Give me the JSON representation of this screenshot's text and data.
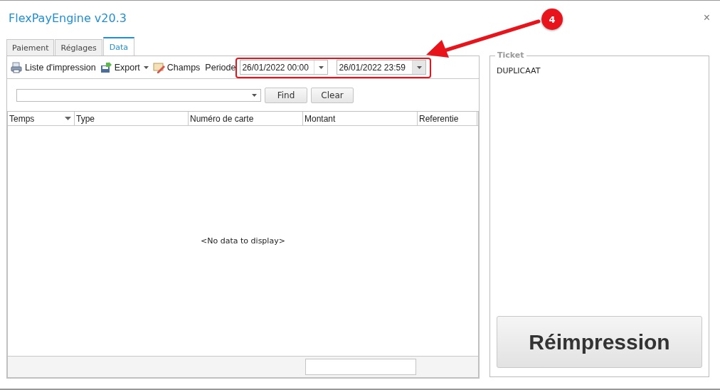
{
  "window": {
    "title": "FlexPayEngine v20.3",
    "close": "×"
  },
  "tabs": [
    {
      "label": "Paiement",
      "selected": false
    },
    {
      "label": "Réglages",
      "selected": false
    },
    {
      "label": "Data",
      "selected": true
    }
  ],
  "toolbar": {
    "items": [
      {
        "label": "Liste d'impression",
        "kind": "print"
      },
      {
        "label": "Export",
        "kind": "export"
      },
      {
        "label": "Champs",
        "kind": "fields"
      }
    ],
    "period_label": "Periode",
    "date_from": "26/01/2022 00:00",
    "date_to": "26/01/2022 23:59"
  },
  "search": {
    "find": "Find",
    "clear": "Clear"
  },
  "table": {
    "columns": [
      {
        "label": "Temps",
        "filter": true
      },
      {
        "label": "Type",
        "filter": false
      },
      {
        "label": "Numéro de carte",
        "filter": false
      },
      {
        "label": "Montant",
        "filter": false
      },
      {
        "label": "Referentie",
        "filter": false
      }
    ],
    "empty_text": "<No data to display>"
  },
  "ticket": {
    "title": "Ticket",
    "text": "DUPLICAAT",
    "button": "Réimpression"
  },
  "annotation": {
    "badge": "4"
  }
}
